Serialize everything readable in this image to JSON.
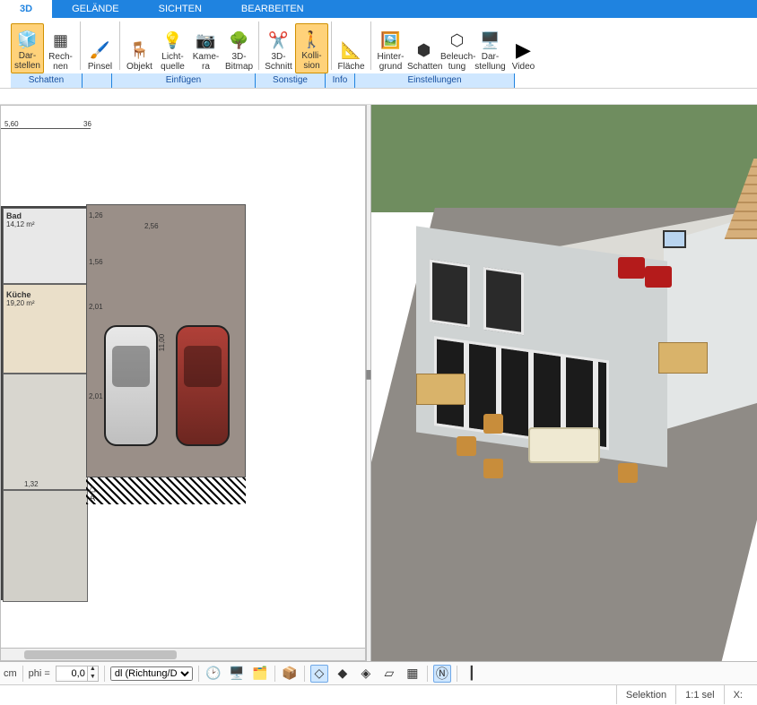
{
  "tabs": {
    "t0": "3D",
    "t1": "GELÄNDE",
    "t2": "SICHTEN",
    "t3": "BEARBEITEN"
  },
  "ribbon": {
    "darstellen": "Dar-\nstellen",
    "rechnen": "Rech-\nnen",
    "pinsel": "Pinsel",
    "objekt": "Objekt",
    "lichtquelle": "Licht-\nquelle",
    "kamera": "Kame-\nra",
    "bitmap": "3D-\nBitmap",
    "schnitt": "3D-\nSchnitt",
    "kollision": "Kolli-\nsion",
    "flaeche": "Fläche",
    "hintergrund": "Hinter-\ngrund",
    "schatten": "Schatten",
    "beleuchtung": "Beleuch-\ntung",
    "darstellung": "Dar-\nstellung",
    "video": "Video"
  },
  "groups": {
    "g1": "Schatten",
    "g2": "",
    "g3": "Einfügen",
    "g4": "Sonstige",
    "g5": "Info",
    "g6": "Einstellungen"
  },
  "plan": {
    "bad_name": "Bad",
    "bad_area": "14,12 m²",
    "kueche_name": "Küche",
    "kueche_area": "19,20 m²",
    "dim_top": "5,60",
    "dim_top2": "36",
    "dim_r1": "1,26",
    "dim_r2": "2,56",
    "dim_r3": "1,56",
    "dim_r4": "2,01",
    "dim_r5": "11,00",
    "dim_r6": "2,01",
    "dim_r7": "1,32",
    "section_arrow": "△",
    "section_letter": "A"
  },
  "footer": {
    "unit": "cm",
    "phi_label": "phi =",
    "phi_value": "0,0",
    "dl_option": "dl (Richtung/Di"
  },
  "status": {
    "selektion": "Selektion",
    "scale": "1:1 sel",
    "coord_label": "X:"
  }
}
